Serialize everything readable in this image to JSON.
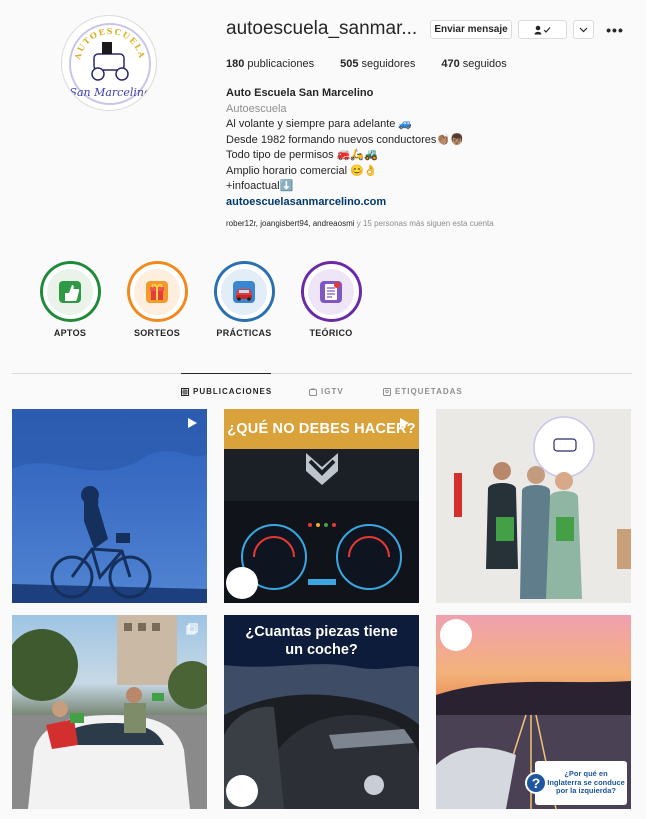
{
  "profile": {
    "username": "autoescuela_sanmar...",
    "logo_top_text": "AUTOESCUELA",
    "logo_script_text": "San Marcelino"
  },
  "actions": {
    "message_label": "Enviar mensaje",
    "follow_icon": "person-check-icon",
    "chevron_icon": "chevron-down-icon",
    "more_icon": "more-horizontal-icon",
    "more_glyph": "•••"
  },
  "stats": [
    {
      "value": "180",
      "label": "publicaciones"
    },
    {
      "value": "505",
      "label": "seguidores"
    },
    {
      "value": "470",
      "label": "seguidos"
    }
  ],
  "bio": {
    "full_name": "Auto Escuela San Marcelino",
    "category": "Autoescuela",
    "line1": "Al volante y siempre para adelante 🚙",
    "line2": "Desde 1982 formando nuevos conductores👏🏽👦🏽",
    "line3": "Todo tipo de permisos 🚒🛵🚜",
    "line4": "Amplio horario comercial 😊👌",
    "line5": "+infoactual⬇️",
    "website": "autoescuelasanmarcelino.com"
  },
  "followed_by": {
    "users": "rober12r, joangisbert94, andreaosmi",
    "rest": " y 15 personas más siguen esta cuenta"
  },
  "highlights": [
    {
      "label": "APTOS",
      "color": "#1f8a3a"
    },
    {
      "label": "SORTEOS",
      "color": "#f08a1c"
    },
    {
      "label": "PRÁCTICAS",
      "color": "#2a6fb0"
    },
    {
      "label": "TEÓRICO",
      "color": "#6a2aa5"
    }
  ],
  "tabs": [
    {
      "label": "PUBLICACIONES",
      "icon": "grid-icon",
      "active": true
    },
    {
      "label": "IGTV",
      "icon": "igtv-icon",
      "active": false
    },
    {
      "label": "ETIQUETADAS",
      "icon": "tag-icon",
      "active": false
    }
  ],
  "posts": {
    "p2_title": "¿QUÉ NO DEBES HACER?",
    "p5_title": "¿Cuantas piezas tiene un coche?",
    "p6_question": "¿Por qué en Inglaterra se conduce por la izquierda?",
    "p6_question_mark": "?"
  },
  "colors": {
    "accent": "#0095f6",
    "text": "#262626",
    "muted": "#8e8e8e",
    "border": "#dbdbdb",
    "brand_blue": "#1e56a0",
    "post2_banner": "#d9a23a"
  }
}
